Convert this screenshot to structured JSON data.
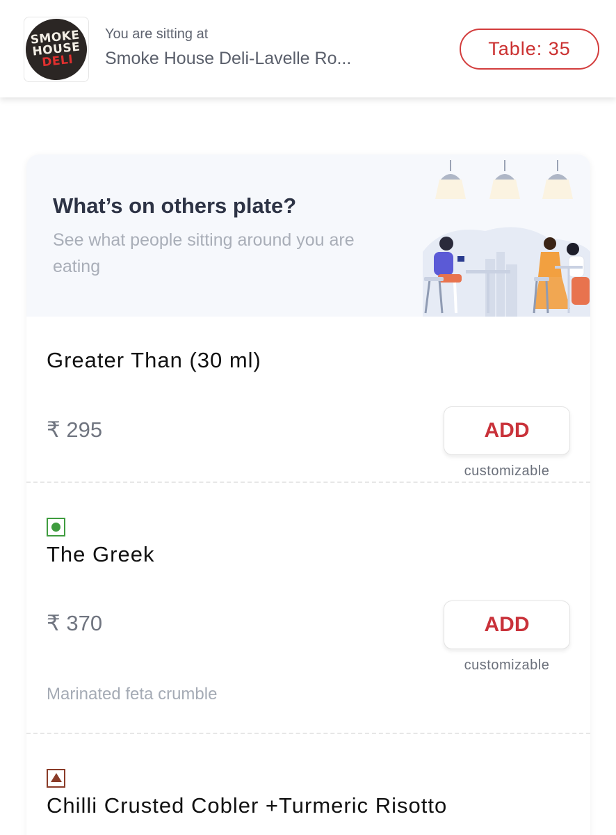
{
  "header": {
    "logo_text": [
      "SMOKE",
      "HOUSE",
      "DELI"
    ],
    "sitting_label": "You are sitting at",
    "venue_name": "Smoke House Deli-Lavelle Ro...",
    "table_label": "Table: 35"
  },
  "promo": {
    "title": "What’s on others plate?",
    "subtitle": "See what people sitting around you are eating"
  },
  "menu": {
    "items": [
      {
        "name": "Greater Than (30 ml)",
        "price": "₹ 295",
        "add_label": "ADD",
        "customizable": "customizable",
        "description": "",
        "diet": "none"
      },
      {
        "name": "The Greek",
        "price": "₹ 370",
        "add_label": "ADD",
        "customizable": "customizable",
        "description": "Marinated feta crumble",
        "diet": "veg"
      },
      {
        "name": "Chilli Crusted Cobler +Turmeric Risotto",
        "price": "",
        "add_label": "",
        "customizable": "",
        "description": "",
        "diet": "non-veg"
      }
    ]
  },
  "colors": {
    "accent_red": "#cb3030",
    "veg_green": "#3f9c3f",
    "nonveg_brown": "#8a3b28",
    "promo_bg": "#f6f8fc"
  },
  "icons": {
    "veg": "veg-indicator-icon",
    "nonveg": "nonveg-indicator-icon"
  }
}
